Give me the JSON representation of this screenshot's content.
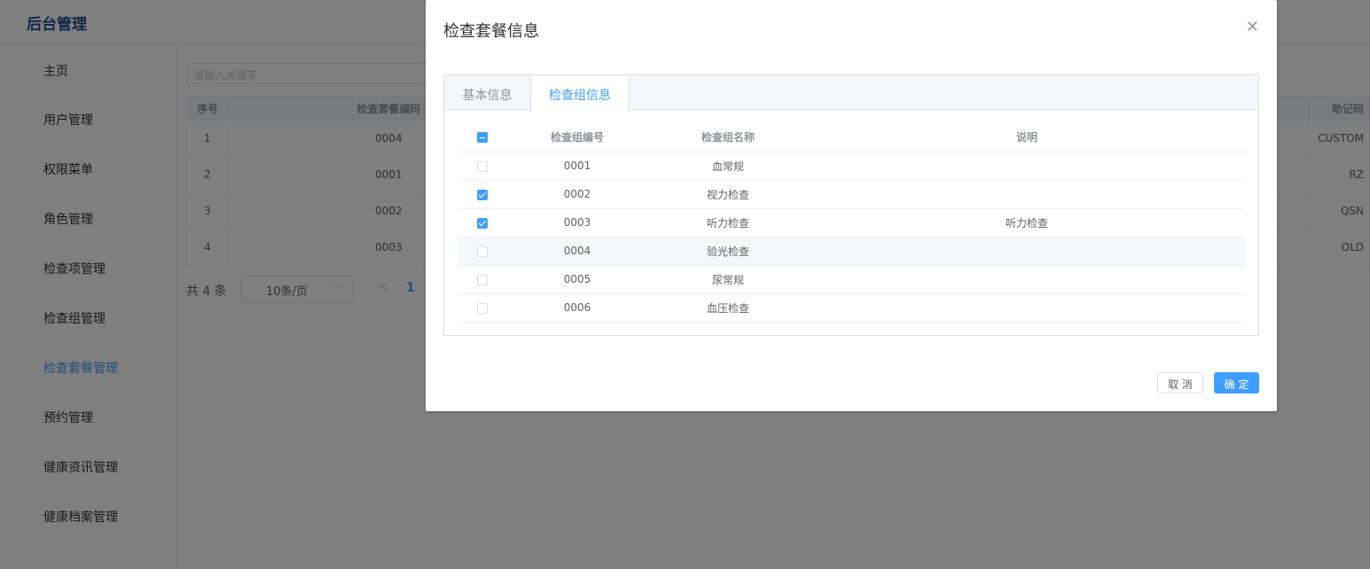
{
  "app": {
    "title": "后台管理"
  },
  "sidebar": {
    "items": [
      {
        "label": "主页"
      },
      {
        "label": "用户管理"
      },
      {
        "label": "权限菜单"
      },
      {
        "label": "角色管理"
      },
      {
        "label": "检查项管理"
      },
      {
        "label": "检查组管理"
      },
      {
        "label": "检查套餐管理",
        "active": true
      },
      {
        "label": "预约管理"
      },
      {
        "label": "健康资讯管理"
      },
      {
        "label": "健康档案管理"
      }
    ]
  },
  "main": {
    "search": {
      "placeholder": "请输入关键字"
    },
    "table": {
      "headers": [
        "序号",
        "检查套餐编码",
        "",
        "助记码"
      ],
      "rows": [
        {
          "index": "1",
          "code": "0004",
          "mnemonic": "CUSTOM"
        },
        {
          "index": "2",
          "code": "0001",
          "mnemonic": "RZ"
        },
        {
          "index": "3",
          "code": "0002",
          "mnemonic": "QSN"
        },
        {
          "index": "4",
          "code": "0003",
          "mnemonic": "OLD"
        }
      ]
    },
    "pagination": {
      "total": "共 4 条",
      "page_size": "10条/页",
      "current_page": "1"
    }
  },
  "dialog": {
    "title": "检查套餐信息",
    "tabs": [
      {
        "label": "基本信息"
      },
      {
        "label": "检查组信息",
        "active": true
      }
    ],
    "group_table": {
      "headers": [
        "检查组编号",
        "检查组名称",
        "说明"
      ],
      "rows": [
        {
          "code": "0001",
          "name": "血常规",
          "remark": "",
          "checked": false
        },
        {
          "code": "0002",
          "name": "视力检查",
          "remark": "",
          "checked": true
        },
        {
          "code": "0003",
          "name": "听力检查",
          "remark": "听力检查",
          "checked": true
        },
        {
          "code": "0004",
          "name": "验光检查",
          "remark": "",
          "checked": false
        },
        {
          "code": "0005",
          "name": "尿常规",
          "remark": "",
          "checked": false
        },
        {
          "code": "0006",
          "name": "血压检查",
          "remark": "",
          "checked": false
        }
      ]
    },
    "buttons": {
      "cancel": "取 消",
      "confirm": "确 定"
    }
  },
  "colors": {
    "primary": "#409eff",
    "logo": "#1d4f91",
    "overlay": "rgba(0,0,0,0.5)"
  },
  "icons": {
    "close": "close-icon",
    "dropdown": "chevron-down-icon",
    "prev": "chevron-left-icon"
  }
}
